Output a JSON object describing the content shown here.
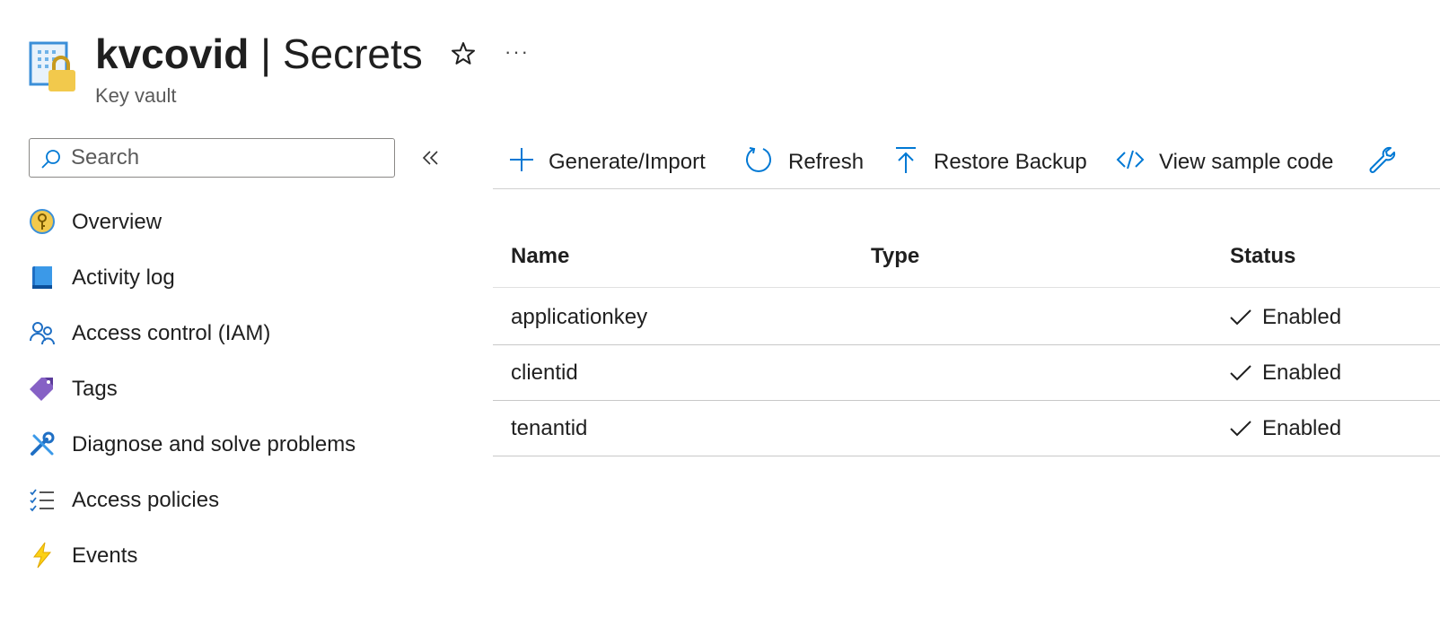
{
  "header": {
    "resource_name": "kvcovid",
    "separator": " | ",
    "page_name": "Secrets",
    "resource_type": "Key vault",
    "more_label": "···",
    "icon": "key-vault-icon"
  },
  "search": {
    "placeholder": "Search",
    "value": ""
  },
  "nav": {
    "items": [
      {
        "label": "Overview",
        "icon": "overview-key-icon"
      },
      {
        "label": "Activity log",
        "icon": "activity-log-icon"
      },
      {
        "label": "Access control (IAM)",
        "icon": "people-icon"
      },
      {
        "label": "Tags",
        "icon": "tag-icon"
      },
      {
        "label": "Diagnose and solve problems",
        "icon": "wrench-icon"
      },
      {
        "label": "Access policies",
        "icon": "checklist-icon"
      },
      {
        "label": "Events",
        "icon": "lightning-icon"
      }
    ]
  },
  "toolbar": {
    "generate": "Generate/Import",
    "refresh": "Refresh",
    "restore": "Restore Backup",
    "sample": "View sample code"
  },
  "table": {
    "columns": [
      "Name",
      "Type",
      "Status"
    ],
    "rows": [
      {
        "name": "applicationkey",
        "type": "",
        "status": "Enabled"
      },
      {
        "name": "clientid",
        "type": "",
        "status": "Enabled"
      },
      {
        "name": "tenantid",
        "type": "",
        "status": "Enabled"
      }
    ]
  },
  "colors": {
    "accent": "#0078d4",
    "key_gold": "#f2c94c",
    "tag_purple": "#8661c5",
    "events_yellow": "#fcd116"
  }
}
